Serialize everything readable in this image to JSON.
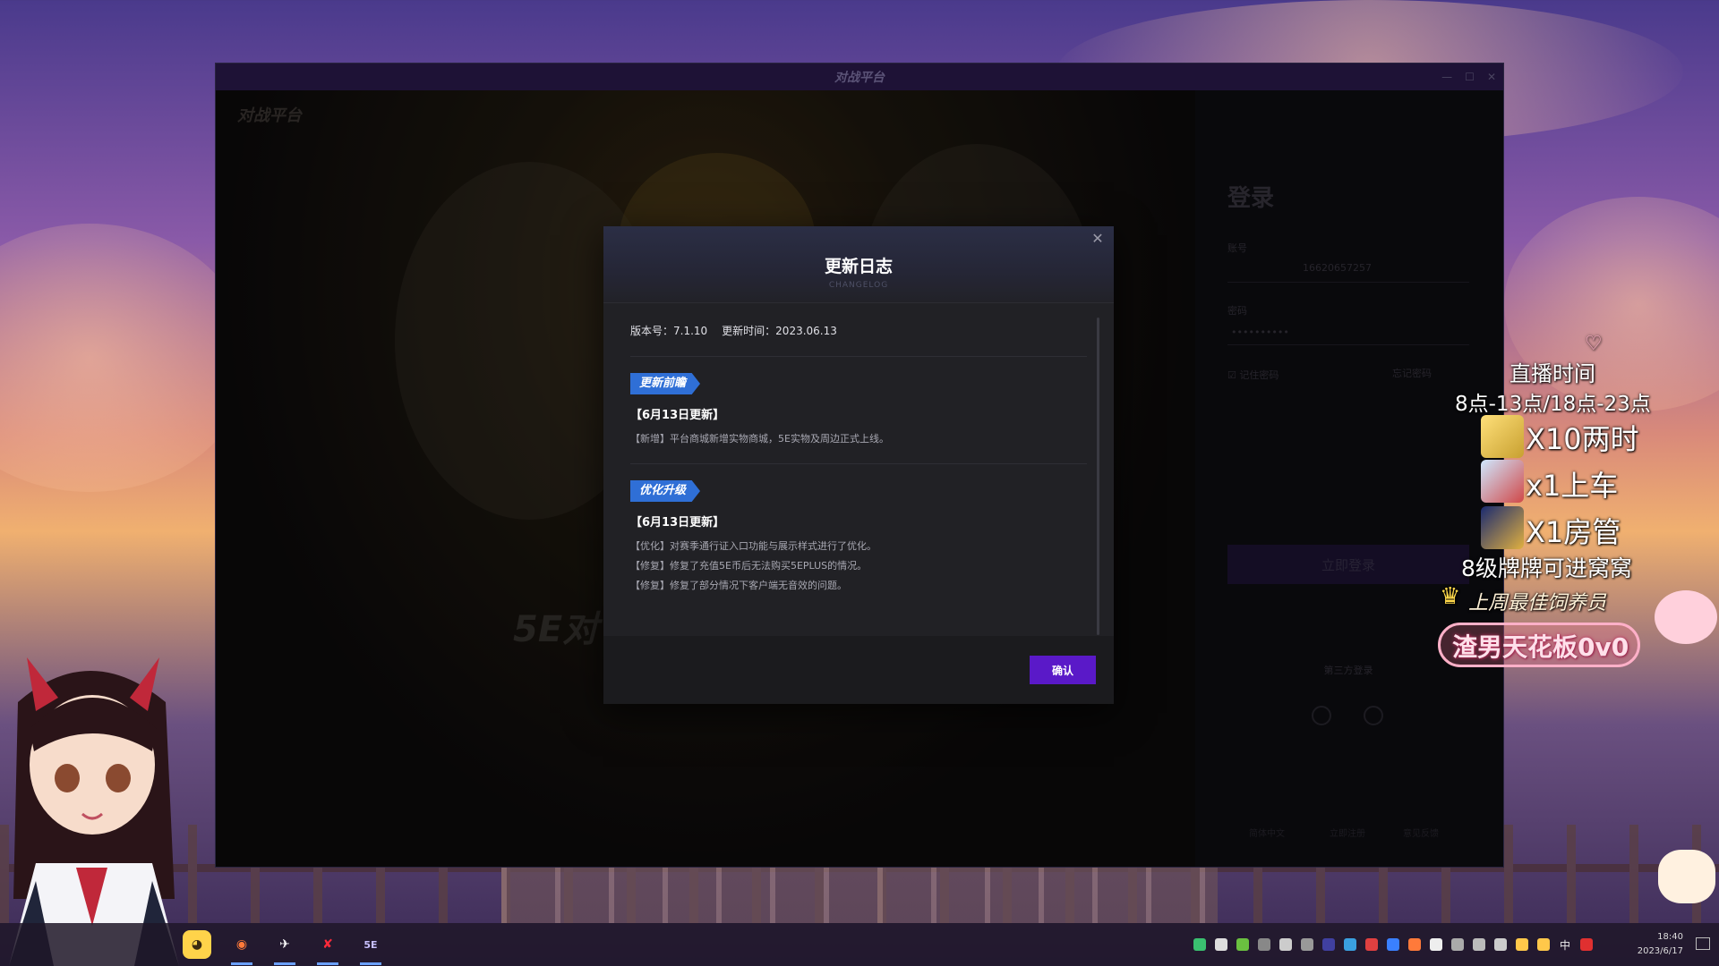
{
  "client": {
    "title": "对战平台",
    "logo_text": "对战平台",
    "splash_text": "5E对",
    "login": {
      "title": "登录",
      "account_label": "账号",
      "account_value": "16620657257",
      "password_label": "密码",
      "password_value": "••••••••••",
      "remember_label": "记住密码",
      "forgot_label": "忘记密码",
      "login_button": "立即登录",
      "third_party_label": "第三方登录",
      "footer": [
        "简体中文",
        "立即注册",
        "意见反馈"
      ]
    }
  },
  "modal": {
    "title": "更新日志",
    "subtitle": "CHANGELOG",
    "version": "版本号：7.1.10",
    "update_time": "更新时间：2023.06.13",
    "sections": [
      {
        "tag": "更新前瞻",
        "date": "【6月13日更新】",
        "lines": [
          "【新增】平台商城新增实物商城，5E实物及周边正式上线。"
        ]
      },
      {
        "tag": "优化升级",
        "date": "【6月13日更新】",
        "lines": [
          "【优化】对赛季通行证入口功能与展示样式进行了优化。",
          "【修复】修复了充值5E币后无法购买5EPLUS的情况。",
          "【修复】修复了部分情况下客户端无音效的问题。"
        ]
      }
    ],
    "confirm": "确认"
  },
  "overlay": {
    "schedule_title": "直播时间",
    "schedule": "8点-13点/18点-23点",
    "rewards": [
      "X10两时",
      "x1上车",
      "X1房管"
    ],
    "level_note": "8级牌牌可进窝窝",
    "best_feeder_label": "上周最佳饲养员",
    "best_feeder_name": "渣男天花板0v0"
  },
  "taskbar": {
    "ime": "中",
    "time": "18:40",
    "date": "2023/6/17"
  },
  "colors": {
    "accent": "#5a19c8",
    "tag_blue": "#2f6fd6",
    "modal_bg": "#212125"
  }
}
